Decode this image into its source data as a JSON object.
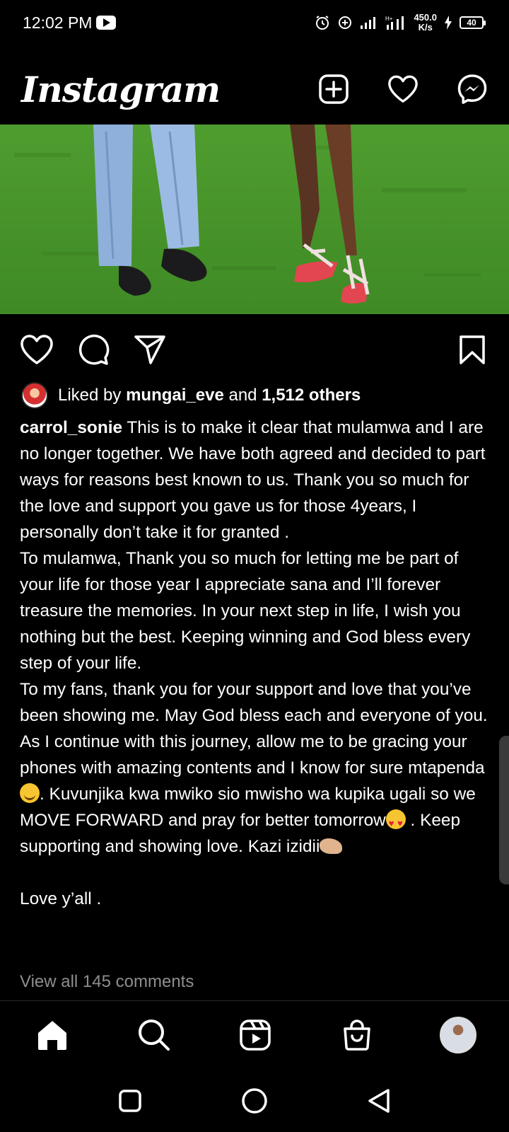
{
  "status_bar": {
    "time": "12:02 PM",
    "net_speed_value": "450.0",
    "net_speed_unit": "K/s",
    "battery": "40"
  },
  "app": {
    "logo": "Instagram"
  },
  "post": {
    "likes": {
      "prefix": "Liked by ",
      "user": "mungai_eve",
      "connector": " and ",
      "others": "1,512 others"
    },
    "caption": {
      "username": "carrol_sonie",
      "p1": "This is to make it clear that mulamwa and I are no longer together. We have both agreed and decided to part ways for reasons best known to us. Thank you so much for the love and support you gave us for those 4years, I personally don’t take it for granted .",
      "p2": "To mulamwa, Thank you so much for letting me be part of your life for those year I appreciate sana and I’ll forever treasure the memories. In your next step in life, I wish you nothing but the best. Keeping winning and God bless every step of your life.",
      "p3a": "To my fans, thank you for your support and love that you’ve been showing me. May God bless each and everyone of you. As I continue with this journey, allow me to be gracing your phones with amazing contents and I know for sure mtapenda",
      "p3b": ". Kuvunjika kwa mwiko sio mwisho wa kupika ugali so we MOVE FORWARD and pray for better tomorrow",
      "p3c": " . Keep supporting and showing love. Kazi izidii",
      "p4": "Love y’all ."
    },
    "view_comments": "View all 145 comments"
  },
  "colors": {
    "background": "#000000",
    "text": "#ffffff",
    "muted": "#8e8e8e"
  }
}
